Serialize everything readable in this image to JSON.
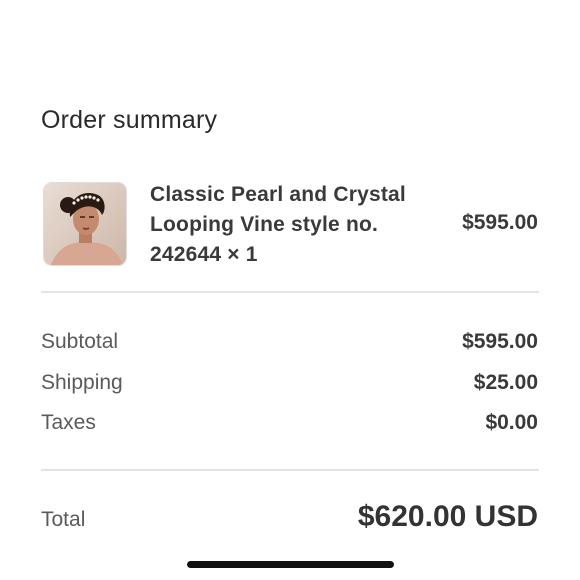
{
  "summary": {
    "title": "Order summary"
  },
  "product": {
    "name": "Classic Pearl and Crystal Looping Vine style no. 242644 × 1",
    "price": "$595.00",
    "image_icon": "bride-photo-thumbnail"
  },
  "costs": {
    "subtotal_label": "Subtotal",
    "subtotal_value": "$595.00",
    "shipping_label": "Shipping",
    "shipping_value": "$25.00",
    "taxes_label": "Taxes",
    "taxes_value": "$0.00"
  },
  "total": {
    "label": "Total",
    "value": "$620.00 USD"
  },
  "colors": {
    "divider": "#e3e3e3",
    "text": "#303030",
    "home_indicator": "#111111"
  }
}
